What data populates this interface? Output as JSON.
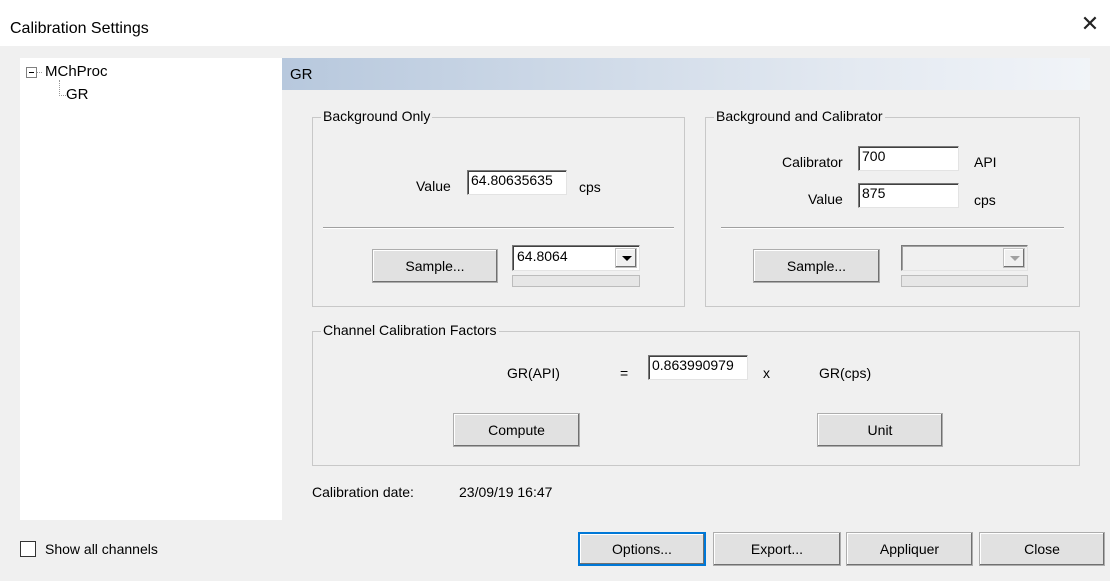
{
  "window": {
    "title": "Calibration Settings",
    "close_label": "✕"
  },
  "tree": {
    "root_label": "MChProc",
    "child_label": "GR"
  },
  "section": {
    "title": "GR"
  },
  "background_only": {
    "legend": "Background Only",
    "value_label": "Value",
    "value": "64.80635635",
    "unit": "cps",
    "sample_label": "Sample...",
    "sample_combo_value": "64.8064"
  },
  "background_calibrator": {
    "legend": "Background and Calibrator",
    "calibrator_label": "Calibrator",
    "calibrator_value": "700",
    "calibrator_unit": "API",
    "value_label": "Value",
    "value": "875",
    "value_unit": "cps",
    "sample_label": "Sample...",
    "sample_combo_value": ""
  },
  "factors": {
    "legend": "Channel Calibration Factors",
    "lhs": "GR(API)",
    "equals": "=",
    "factor": "0.863990979",
    "times": "x",
    "rhs": "GR(cps)",
    "compute_label": "Compute",
    "unit_label": "Unit"
  },
  "calibration": {
    "date_label": "Calibration date:",
    "date_value": "23/09/19 16:47"
  },
  "footer": {
    "show_all_label": "Show all channels",
    "show_all_checked": false,
    "options_label": "Options...",
    "export_label": "Export...",
    "apply_label": "Appliquer",
    "close_label": "Close"
  }
}
